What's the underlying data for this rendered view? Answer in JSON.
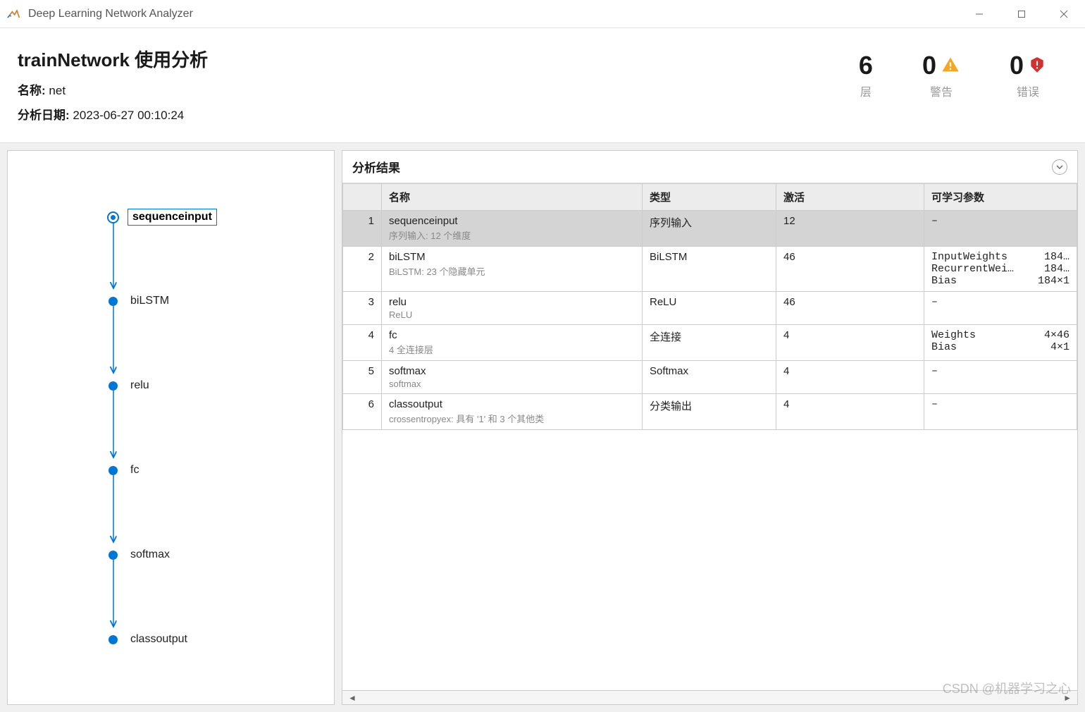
{
  "titlebar": {
    "title": "Deep Learning Network Analyzer"
  },
  "header": {
    "page_title": "trainNetwork 使用分析",
    "name_label": "名称:",
    "name_value": "net",
    "date_label": "分析日期:",
    "date_value": "2023-06-27 00:10:24"
  },
  "stats": {
    "layers": {
      "value": "6",
      "label": "层"
    },
    "warnings": {
      "value": "0",
      "label": "警告"
    },
    "errors": {
      "value": "0",
      "label": "错误"
    }
  },
  "graph_nodes": [
    "sequenceinput",
    "biLSTM",
    "relu",
    "fc",
    "softmax",
    "classoutput"
  ],
  "results": {
    "title": "分析结果",
    "columns": {
      "idx": "",
      "name": "名称",
      "type": "类型",
      "act": "激活",
      "params": "可学习参数"
    },
    "rows": [
      {
        "idx": "1",
        "name": "sequenceinput",
        "desc": "序列输入: 12 个维度",
        "type": "序列输入",
        "act": "12",
        "params": [],
        "dash": "–",
        "selected": true
      },
      {
        "idx": "2",
        "name": "biLSTM",
        "desc": "BiLSTM: 23 个隐藏单元",
        "type": "BiLSTM",
        "act": "46",
        "params": [
          {
            "k": "InputWeights",
            "v": "184…"
          },
          {
            "k": "RecurrentWei…",
            "v": "184…"
          },
          {
            "k": "Bias",
            "v": "184×1"
          }
        ]
      },
      {
        "idx": "3",
        "name": "relu",
        "desc": "ReLU",
        "type": "ReLU",
        "act": "46",
        "params": [],
        "dash": "–"
      },
      {
        "idx": "4",
        "name": "fc",
        "desc": "4 全连接层",
        "type": "全连接",
        "act": "4",
        "params": [
          {
            "k": "Weights",
            "v": "4×46"
          },
          {
            "k": "Bias",
            "v": "4×1"
          }
        ]
      },
      {
        "idx": "5",
        "name": "softmax",
        "desc": "softmax",
        "type": "Softmax",
        "act": "4",
        "params": [],
        "dash": "–"
      },
      {
        "idx": "6",
        "name": "classoutput",
        "desc": "crossentropyex: 具有 '1' 和 3 个其他类",
        "type": "分类输出",
        "act": "4",
        "params": [],
        "dash": "–"
      }
    ]
  },
  "watermark": "CSDN @机器学习之心"
}
